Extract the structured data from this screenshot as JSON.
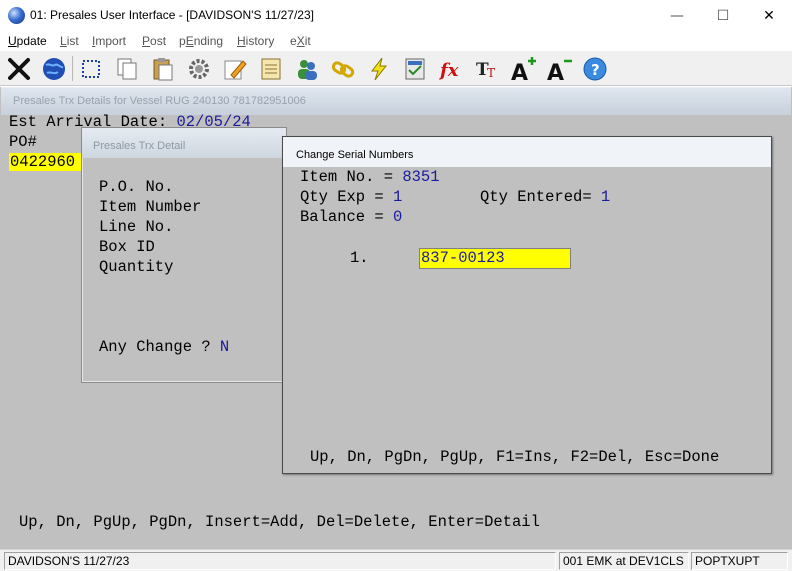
{
  "window": {
    "title": "01: Presales User Interface - [DAVIDSON'S 11/27/23]",
    "controls": {
      "minimize": "—",
      "maximize": "☐",
      "close": "✕"
    }
  },
  "menu": [
    {
      "label": "Update",
      "accel": "U"
    },
    {
      "label": "List",
      "accel": "L"
    },
    {
      "label": "Import",
      "accel": "I"
    },
    {
      "label": "Post",
      "accel": "P"
    },
    {
      "label": "pEnding",
      "accel": "E"
    },
    {
      "label": "History",
      "accel": "H"
    },
    {
      "label": "eXit",
      "accel": "X"
    }
  ],
  "toolbar": [
    "close-x-icon",
    "globe-icon",
    "select-icon",
    "copy-icon",
    "paste-icon",
    "settings-icon",
    "edit-icon",
    "report-icon",
    "users-icon",
    "link-icon",
    "lightning-icon",
    "calculator-icon",
    "function-icon",
    "font-style-icon",
    "font-larger-icon",
    "font-smaller-icon",
    "help-icon"
  ],
  "vessel_window": {
    "title": "Presales Trx Details for Vessel  RUG 240130 781782951006",
    "est_arrival_label": "Est Arrival Date: ",
    "est_arrival_value": "02/05/24",
    "po_label": "PO#",
    "po_value": "0422960",
    "footer": "Up, Dn, PgUp, PgDn, Insert=Add, Del=Delete, Enter=Detail"
  },
  "detail_window": {
    "title": "Presales Trx Detail",
    "fields": [
      "P.O. No.",
      "Item Number",
      "Line No.",
      "Box ID",
      "Quantity"
    ],
    "any_change_label": "Any Change ? ",
    "any_change_value": "N"
  },
  "serial_window": {
    "title": "Change Serial Numbers",
    "item_no_label": "Item No. = ",
    "item_no_value": "8351",
    "qty_exp_label": "Qty Exp = ",
    "qty_exp_value": "1",
    "qty_entered_label": "Qty Entered= ",
    "qty_entered_value": "1",
    "balance_label": "Balance = ",
    "balance_value": "0",
    "row_number": "1.",
    "serial_value": "837-00123",
    "footer": "Up, Dn, PgDn, PgUp, F1=Ins, F2=Del, Esc=Done"
  },
  "status_bar": {
    "company": "DAVIDSON'S 11/27/23",
    "user": "001 EMK at DEV1CLS",
    "program": "POPTXUPT"
  },
  "colors": {
    "highlight": "#ffff00",
    "value_text": "#1a1a9c",
    "panel": "#c0c0c0"
  }
}
